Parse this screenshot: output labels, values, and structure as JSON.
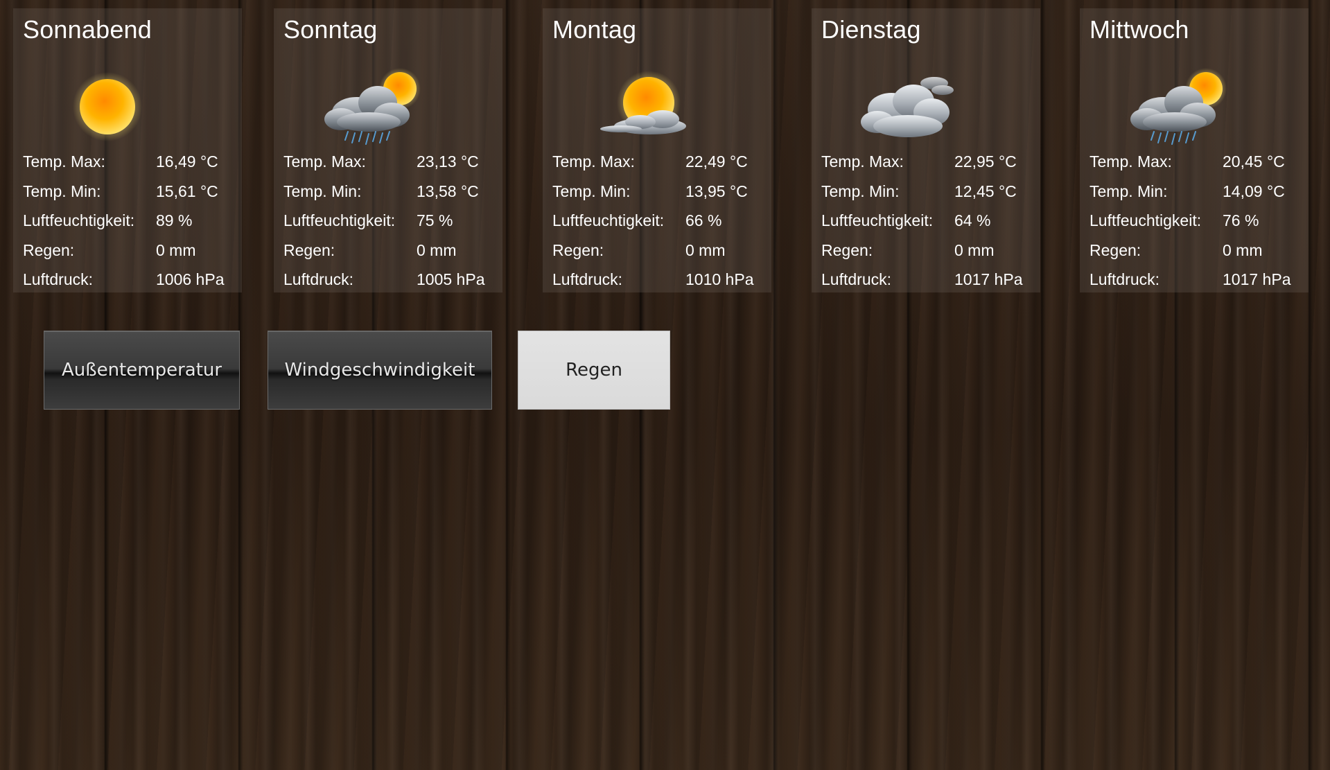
{
  "labels": {
    "temp_max": "Temp. Max:",
    "temp_min": "Temp. Min:",
    "humidity": "Luftfeuchtigkeit:",
    "rain": "Regen:",
    "pressure": "Luftdruck:"
  },
  "days": [
    {
      "name": "Sonnabend",
      "icon": "sun-icon",
      "temp_max": "16,49 °C",
      "temp_min": "15,61 °C",
      "humidity": "89 %",
      "rain": "0 mm",
      "pressure": "1006 hPa"
    },
    {
      "name": "Sonntag",
      "icon": "rain-cloud-sun-icon",
      "temp_max": "23,13 °C",
      "temp_min": "13,58 °C",
      "humidity": "75 %",
      "rain": "0 mm",
      "pressure": "1005 hPa"
    },
    {
      "name": "Montag",
      "icon": "sun-behind-cloud-icon",
      "temp_max": "22,49 °C",
      "temp_min": "13,95 °C",
      "humidity": "66 %",
      "rain": "0 mm",
      "pressure": "1010 hPa"
    },
    {
      "name": "Dienstag",
      "icon": "cloudy-icon",
      "temp_max": "22,95 °C",
      "temp_min": "12,45 °C",
      "humidity": "64 %",
      "rain": "0 mm",
      "pressure": "1017 hPa"
    },
    {
      "name": "Mittwoch",
      "icon": "rain-cloud-sun-icon",
      "temp_max": "20,45 °C",
      "temp_min": "14,09 °C",
      "humidity": "76 %",
      "rain": "0 mm",
      "pressure": "1017 hPa"
    }
  ],
  "buttons": {
    "outdoor_temp": "Außentemperatur",
    "wind_speed": "Windgeschwindigkeit",
    "rain": "Regen"
  },
  "colors": {
    "sun": "#f7a800",
    "cloud": "#b9bec4",
    "rain": "#4a90c8",
    "selected_button": "#dcdcdc"
  }
}
